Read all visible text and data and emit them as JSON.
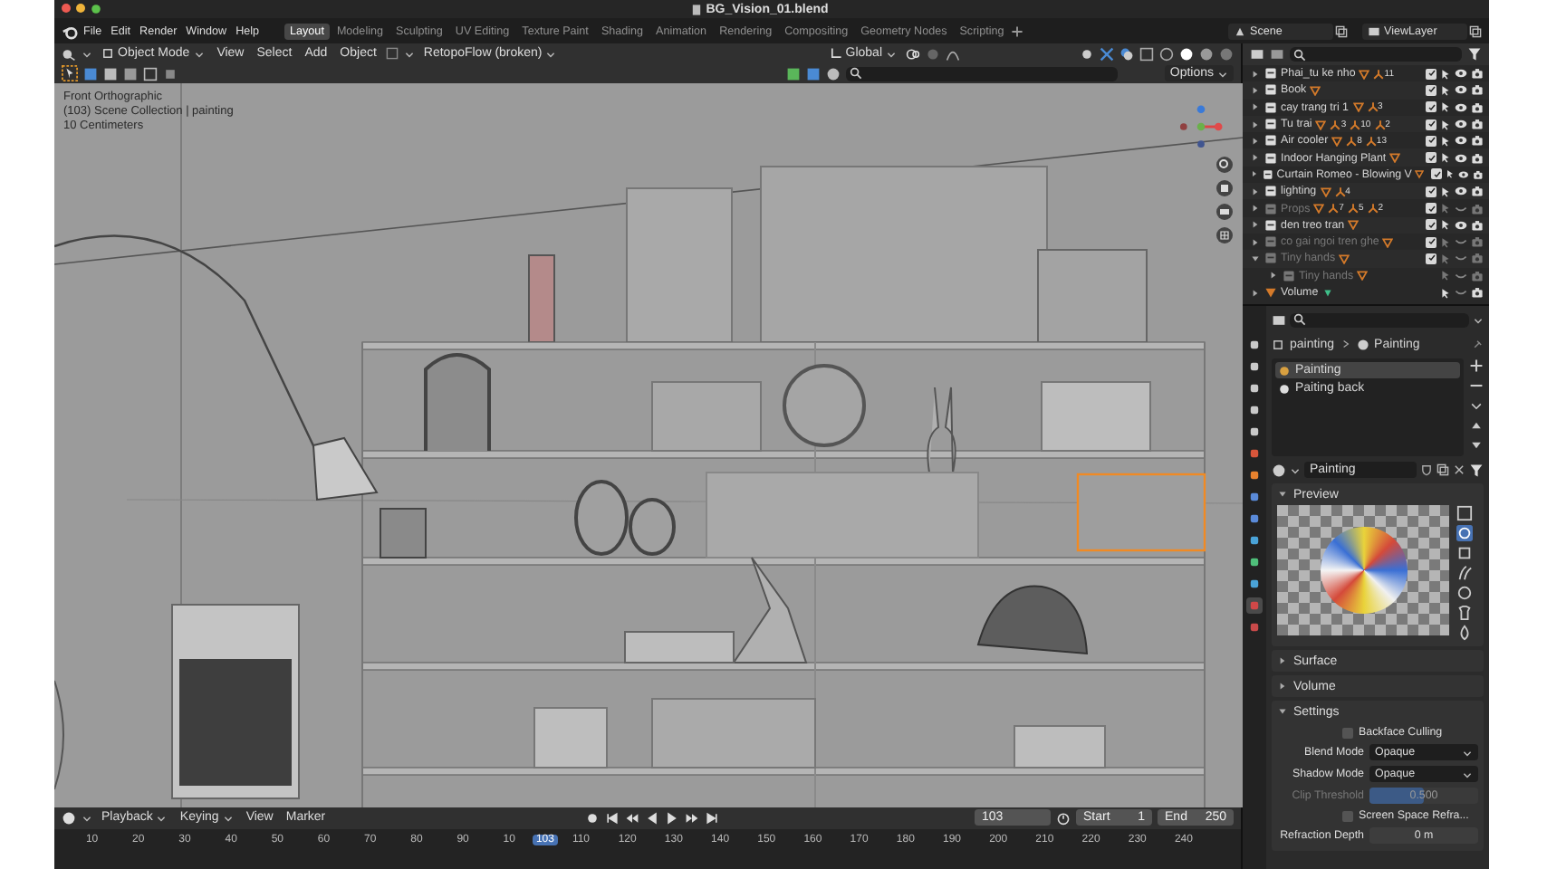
{
  "window": {
    "title": "BG_Vision_01.blend"
  },
  "menu": [
    "File",
    "Edit",
    "Render",
    "Window",
    "Help"
  ],
  "workspaces": [
    {
      "label": "Layout",
      "selected": true
    },
    {
      "label": "Modeling",
      "selected": false
    },
    {
      "label": "Sculpting",
      "selected": false
    },
    {
      "label": "UV Editing",
      "selected": false
    },
    {
      "label": "Texture Paint",
      "selected": false
    },
    {
      "label": "Shading",
      "selected": false
    },
    {
      "label": "Animation",
      "selected": false
    },
    {
      "label": "Rendering",
      "selected": false
    },
    {
      "label": "Compositing",
      "selected": false
    },
    {
      "label": "Geometry Nodes",
      "selected": false
    },
    {
      "label": "Scripting",
      "selected": false
    }
  ],
  "scene": "Scene",
  "view_layer": "ViewLayer",
  "viewport": {
    "mode": "Object Mode",
    "menus": [
      "View",
      "Select",
      "Add",
      "Object"
    ],
    "addon": "RetopoFlow (broken)",
    "orientation": "Global",
    "options": "Options",
    "overlay": [
      "Front Orthographic",
      "(103) Scene Collection | painting",
      "10 Centimeters"
    ]
  },
  "timeline": {
    "menus": [
      {
        "label": "Playback",
        "dropdown": true
      },
      {
        "label": "Keying",
        "dropdown": true
      },
      {
        "label": "View",
        "dropdown": false
      },
      {
        "label": "Marker",
        "dropdown": false
      }
    ],
    "current_frame": "103",
    "start_label": "Start",
    "start": "1",
    "end_label": "End",
    "end": "250",
    "ruler": [
      {
        "kind": "tick",
        "label": "10"
      },
      {
        "kind": "tick",
        "label": "20"
      },
      {
        "kind": "tick",
        "label": "30"
      },
      {
        "kind": "tick",
        "label": "40"
      },
      {
        "kind": "tick",
        "label": "50"
      },
      {
        "kind": "tick",
        "label": "60"
      },
      {
        "kind": "tick",
        "label": "70"
      },
      {
        "kind": "tick",
        "label": "80"
      },
      {
        "kind": "tick",
        "label": "90"
      },
      {
        "kind": "tick",
        "label": "10"
      },
      {
        "kind": "current",
        "label": "103"
      },
      {
        "kind": "tick",
        "label": "110"
      },
      {
        "kind": "tick",
        "label": "120"
      },
      {
        "kind": "tick",
        "label": "130"
      },
      {
        "kind": "tick",
        "label": "140"
      },
      {
        "kind": "tick",
        "label": "150"
      },
      {
        "kind": "tick",
        "label": "160"
      },
      {
        "kind": "tick",
        "label": "170"
      },
      {
        "kind": "tick",
        "label": "180"
      },
      {
        "kind": "tick",
        "label": "190"
      },
      {
        "kind": "tick",
        "label": "200"
      },
      {
        "kind": "tick",
        "label": "210"
      },
      {
        "kind": "tick",
        "label": "220"
      },
      {
        "kind": "tick",
        "label": "230"
      },
      {
        "kind": "tick",
        "label": "240"
      }
    ]
  },
  "outliner": {
    "rows": [
      {
        "kind": "collection",
        "name": "Phai_tu ke nho",
        "disabled": false,
        "expanded": false,
        "visible": true,
        "badges": [
          "11"
        ]
      },
      {
        "kind": "collection",
        "name": "Book",
        "disabled": false,
        "expanded": false,
        "visible": true
      },
      {
        "kind": "collection",
        "name": "cay trang tri 1",
        "disabled": false,
        "expanded": false,
        "visible": true,
        "badges": [
          "3"
        ]
      },
      {
        "kind": "collection",
        "name": "Tu trai",
        "disabled": false,
        "expanded": false,
        "visible": true,
        "badges": [
          "3",
          "10",
          "2"
        ]
      },
      {
        "kind": "collection",
        "name": "Air cooler",
        "disabled": false,
        "expanded": false,
        "visible": true,
        "badges": [
          "8",
          "13"
        ]
      },
      {
        "kind": "collection",
        "name": "Indoor Hanging Plant",
        "disabled": false,
        "expanded": false,
        "visible": true
      },
      {
        "kind": "collection",
        "name": "Curtain Romeo - Blowing V",
        "disabled": false,
        "expanded": false,
        "visible": true
      },
      {
        "kind": "collection",
        "name": "lighting",
        "disabled": false,
        "expanded": false,
        "visible": true,
        "badges": [
          "4"
        ]
      },
      {
        "kind": "collection",
        "name": "Props",
        "disabled": true,
        "expanded": false,
        "visible": false,
        "badges": [
          "7",
          "5",
          "2"
        ]
      },
      {
        "kind": "collection",
        "name": "den treo tran",
        "disabled": false,
        "expanded": false,
        "visible": true
      },
      {
        "kind": "collection",
        "name": "co gai ngoi tren ghe",
        "disabled": true,
        "expanded": false,
        "visible": false
      },
      {
        "kind": "collection",
        "name": "Tiny hands",
        "disabled": true,
        "expanded": true,
        "visible": false,
        "children": [
          {
            "kind": "collection",
            "name": "Tiny hands",
            "disabled": true,
            "expanded": false,
            "visible": false
          }
        ]
      },
      {
        "kind": "object",
        "name": "Volume",
        "disabled": false,
        "expanded": false,
        "visible": false
      }
    ]
  },
  "properties": {
    "tabs": [
      {
        "selected": false
      },
      {
        "selected": false
      },
      {
        "selected": false
      },
      {
        "selected": false
      },
      {
        "selected": false
      },
      {
        "selected": false
      },
      {
        "selected": false
      },
      {
        "selected": false
      },
      {
        "selected": false
      },
      {
        "selected": false
      },
      {
        "selected": false
      },
      {
        "selected": false
      },
      {
        "selected": true
      },
      {
        "selected": false
      }
    ],
    "breadcrumb": [
      "painting",
      "Painting"
    ],
    "slots": [
      {
        "name": "Painting",
        "selected": true
      },
      {
        "name": "Paiting back",
        "selected": false
      }
    ],
    "material": "Painting",
    "panels": [
      {
        "kind": "preview",
        "title": "Preview",
        "expanded": true
      },
      {
        "title": "Surface",
        "expanded": false
      },
      {
        "title": "Volume",
        "expanded": false
      },
      {
        "kind": "settings",
        "title": "Settings",
        "expanded": true,
        "fields": [
          {
            "kind": "checkbox",
            "label": "Backface Culling",
            "checked": false
          },
          {
            "kind": "select",
            "label": "Blend Mode",
            "value": "Opaque"
          },
          {
            "kind": "select",
            "label": "Shadow Mode",
            "value": "Opaque"
          },
          {
            "kind": "slider",
            "label": "Clip Threshold",
            "value": "0.500",
            "level": 0.5,
            "disabled": true
          },
          {
            "kind": "checkbox",
            "label": "Screen Space Refra...",
            "checked": false
          },
          {
            "kind": "number",
            "label": "Refraction Depth",
            "value": "0 m"
          }
        ]
      }
    ]
  }
}
